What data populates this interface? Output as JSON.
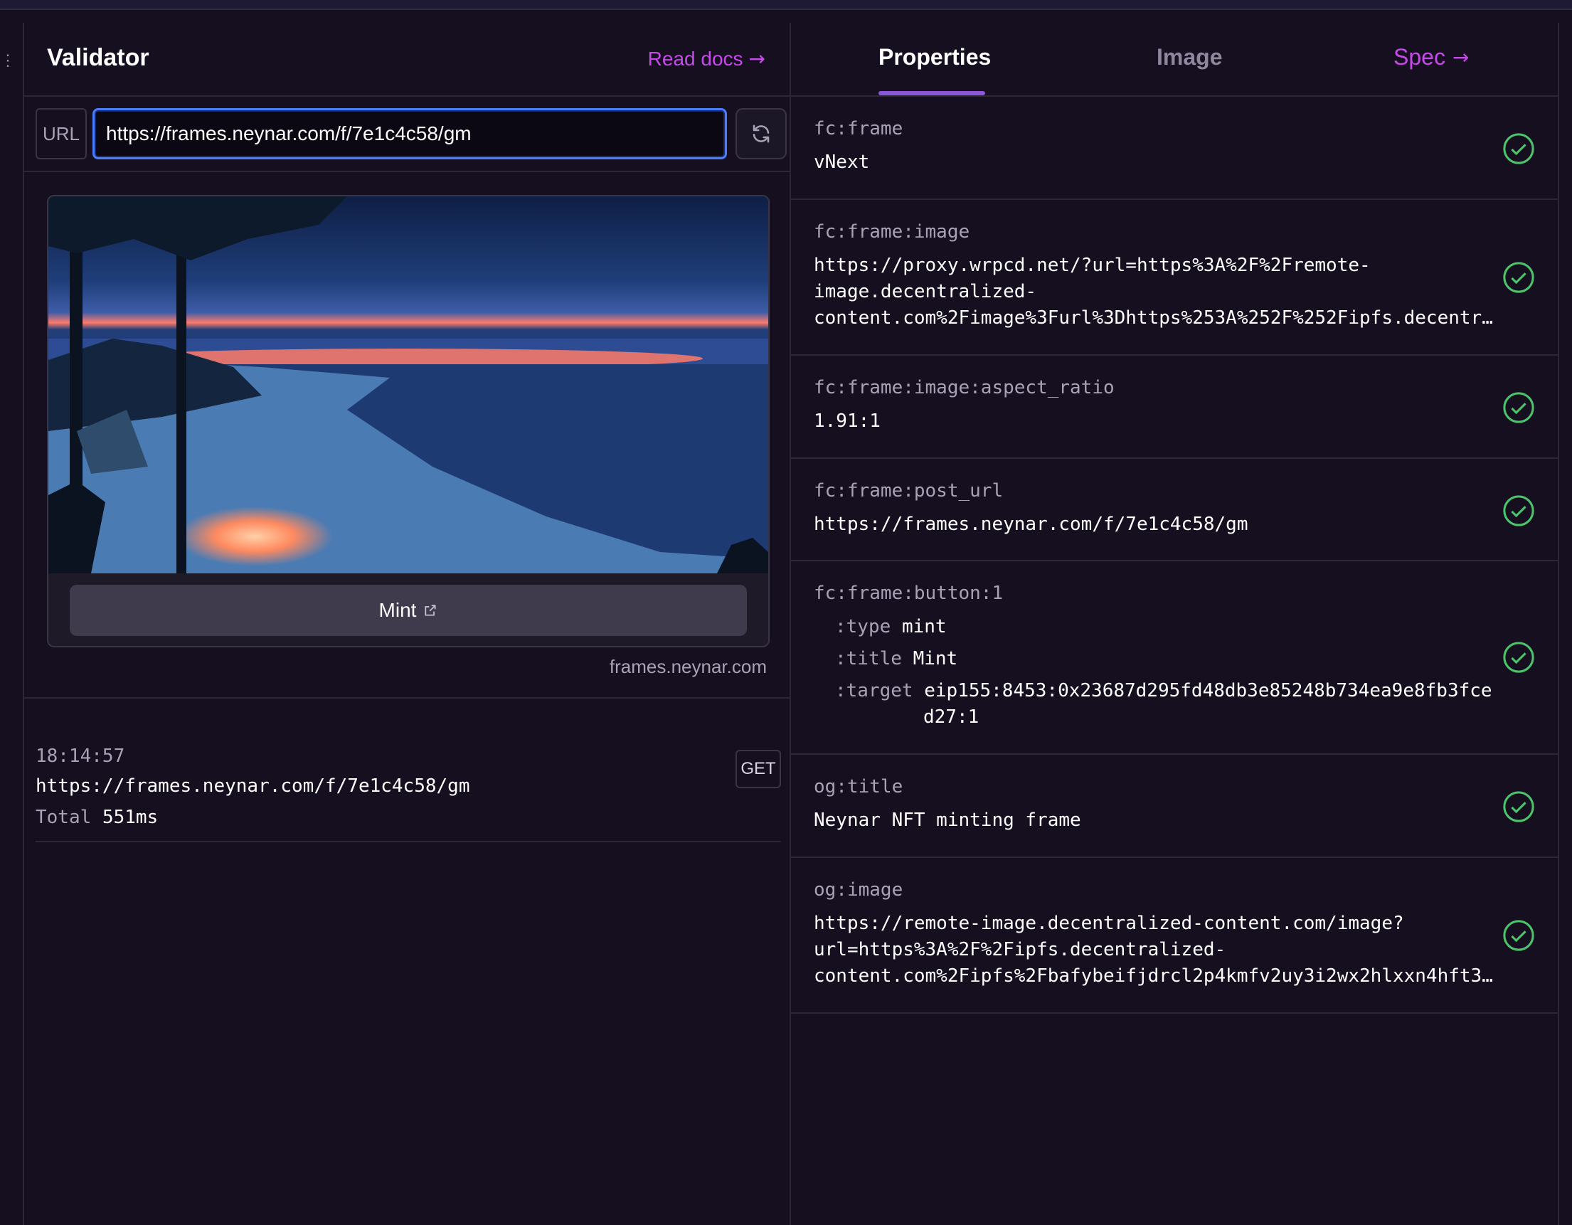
{
  "app": {
    "title": "Validator",
    "read_docs_label": "Read docs"
  },
  "url_bar": {
    "label": "URL",
    "value": "https://frames.neynar.com/f/7e1c4c58/gm"
  },
  "frame_preview": {
    "button_label": "Mint",
    "domain": "frames.neynar.com"
  },
  "request_log": {
    "time": "18:14:57",
    "url": "https://frames.neynar.com/f/7e1c4c58/gm",
    "total_label": "Total",
    "total_value": "551ms",
    "method": "GET"
  },
  "tabs": [
    {
      "label": "Properties",
      "active": true
    },
    {
      "label": "Image",
      "active": false
    },
    {
      "label": "Spec",
      "active": false
    }
  ],
  "properties": [
    {
      "key": "fc:frame",
      "value": "vNext",
      "valid": true
    },
    {
      "key": "fc:frame:image",
      "value": "https://proxy.wrpcd.net/?url=https%3A%2F%2Fremote-image.decentralized-content.com%2Fimage%3Furl%3Dhttps%253A%252F%252Fipfs.decentr…",
      "valid": true
    },
    {
      "key": "fc:frame:image:aspect_ratio",
      "value": "1.91:1",
      "valid": true
    },
    {
      "key": "fc:frame:post_url",
      "value": "https://frames.neynar.com/f/7e1c4c58/gm",
      "valid": true
    },
    {
      "key": "fc:frame:button:1",
      "valid": true,
      "sub": {
        "type_key": ":type",
        "type_val": "mint",
        "title_key": ":title",
        "title_val": "Mint",
        "target_key": ":target",
        "target_val_1": "eip155:8453:0x23687d295fd48db3e85248b734ea9e8fb3fce",
        "target_val_2": "d27:1"
      }
    },
    {
      "key": "og:title",
      "value": "Neynar NFT minting frame",
      "valid": true
    },
    {
      "key": "og:image",
      "value_lines": [
        "https://remote-image.decentralized-content.com/image?",
        "url=https%3A%2F%2Fipfs.decentralized-",
        "content.com%2Fipfs%2Fbafybeifjdrcl2p4kmfv2uy3i2wx2hlxxn4hft3…"
      ],
      "valid": true
    }
  ],
  "image_lines": [
    "https://proxy.wrpcd.net/?url=https%3A%2F%2Fremote-",
    "image.decentralized-",
    "content.com%2Fimage%3Furl%3Dhttps%253A%252F%252Fipfs.decentr…"
  ],
  "colors": {
    "background": "#150f20",
    "accent": "#c64ae8",
    "tab_underline": "#8a57d8",
    "check": "#4cc46a",
    "input_focus": "#4a7dff"
  },
  "icons": {
    "refresh": "refresh-icon",
    "external": "external-link-icon",
    "check": "check-circle-icon"
  }
}
